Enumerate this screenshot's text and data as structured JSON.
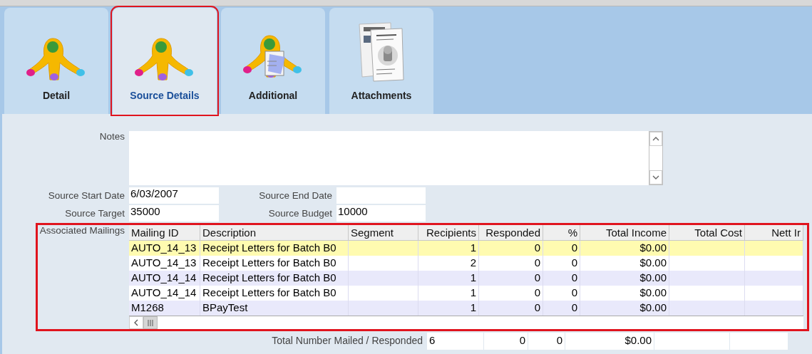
{
  "tabs": [
    {
      "label": "Detail",
      "kind": "tree",
      "selected": false,
      "highlighted": false
    },
    {
      "label": "Source Details",
      "kind": "tree",
      "selected": true,
      "highlighted": true
    },
    {
      "label": "Additional",
      "kind": "notepad",
      "selected": false,
      "highlighted": false
    },
    {
      "label": "Attachments",
      "kind": "documents",
      "selected": false,
      "highlighted": false
    }
  ],
  "notes": {
    "label": "Notes"
  },
  "fields": [
    {
      "label": "Source Start Date",
      "value": "6/03/2007"
    },
    {
      "label": "Source End Date"
    },
    {
      "label": "Source Target",
      "value": "35000"
    },
    {
      "label": "Source Budget",
      "value": "10000"
    }
  ],
  "mailings": {
    "label": "Associated Mailings",
    "highlighted": true,
    "columns": [
      "Mailing ID",
      "Description",
      "Segment",
      "Recipients",
      "Responded",
      "%",
      "Total Income",
      "Total Cost",
      "Nett Ir"
    ],
    "rows": [
      {
        "selected": true,
        "cells": [
          "AUTO_14_13",
          "Receipt Letters for Batch B0",
          "",
          "1",
          "0",
          "0",
          "$0.00",
          "",
          ""
        ]
      },
      {
        "selected": false,
        "cells": [
          "AUTO_14_13",
          "Receipt Letters for Batch B0",
          "",
          "2",
          "0",
          "0",
          "$0.00",
          "",
          ""
        ]
      },
      {
        "selected": false,
        "cells": [
          "AUTO_14_14",
          "Receipt Letters for Batch B0",
          "",
          "1",
          "0",
          "0",
          "$0.00",
          "",
          ""
        ]
      },
      {
        "selected": false,
        "cells": [
          "AUTO_14_14",
          "Receipt Letters for Batch B0",
          "",
          "1",
          "0",
          "0",
          "$0.00",
          "",
          ""
        ]
      },
      {
        "selected": false,
        "cells": [
          "M1268",
          "BPayTest",
          "",
          "1",
          "0",
          "0",
          "$0.00",
          "",
          ""
        ]
      }
    ]
  },
  "totals": {
    "label": "Total Number Mailed / Responded",
    "cells": [
      "6",
      "0",
      "0",
      "$0.00",
      "",
      ""
    ]
  }
}
